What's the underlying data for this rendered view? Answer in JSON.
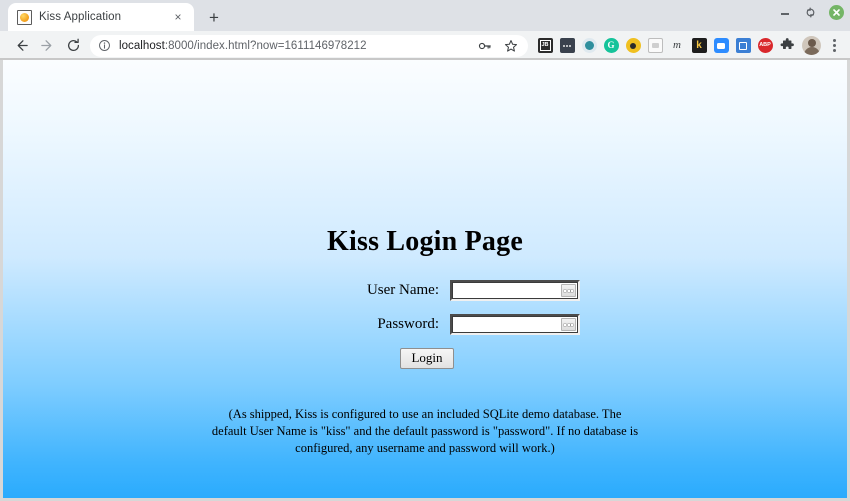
{
  "browser": {
    "tab": {
      "title": "Kiss Application",
      "favicon": "kiss-orange-circle-icon",
      "close_label": "×"
    },
    "new_tab_label": "+",
    "window_controls": {
      "minimize": "minimize-icon",
      "maximize": "maximize-icon",
      "close": "close-icon"
    },
    "nav": {
      "back": "back-arrow-icon",
      "forward": "forward-arrow-icon",
      "reload": "reload-icon"
    },
    "omnibox": {
      "site_info_icon": "info-circle-icon",
      "url_host": "localhost",
      "url_rest": ":8000/index.html?now=1611146978212",
      "full_url": "localhost:8000/index.html?now=1611146978212",
      "key_icon": "key-icon",
      "bookmark_icon": "star-icon"
    },
    "extensions": [
      {
        "name": "jetbrains-toolbox-extension",
        "label": "JB"
      },
      {
        "name": "dots-extension",
        "label": "•••"
      },
      {
        "name": "teal-circle-extension",
        "label": ""
      },
      {
        "name": "grammarly-extension",
        "label": "G"
      },
      {
        "name": "gold-circle-extension",
        "label": ""
      },
      {
        "name": "clipboard-extension",
        "label": ""
      },
      {
        "name": "momentum-extension",
        "label": "m"
      },
      {
        "name": "kite-extension",
        "label": "k"
      },
      {
        "name": "zoom-extension",
        "label": ""
      },
      {
        "name": "blue-square-extension",
        "label": ""
      },
      {
        "name": "adblock-plus-extension",
        "label": "ABP"
      },
      {
        "name": "puzzle-extensions-button",
        "label": ""
      }
    ],
    "profile_avatar": "user-avatar",
    "menu": "three-dot-menu-icon"
  },
  "page": {
    "title": "Kiss Login Page",
    "form": {
      "username": {
        "label": "User Name:",
        "value": "",
        "placeholder": "",
        "autofill_icon": "autofill-dots-icon"
      },
      "password": {
        "label": "Password:",
        "value": "",
        "placeholder": "",
        "autofill_icon": "autofill-dots-icon"
      },
      "submit_label": "Login"
    },
    "note": "(As shipped, Kiss is configured to use an included SQLite demo database. The default User Name is \"kiss\" and the default password is \"password\". If no database is configured, any username and password will work.)"
  },
  "colors": {
    "tabstrip_bg": "#dee1e6",
    "toolbar_bg": "#f1f3f4",
    "page_gradient_top": "#fbfdff",
    "page_gradient_bottom": "#2aabfd",
    "close_button": "#74b566"
  }
}
